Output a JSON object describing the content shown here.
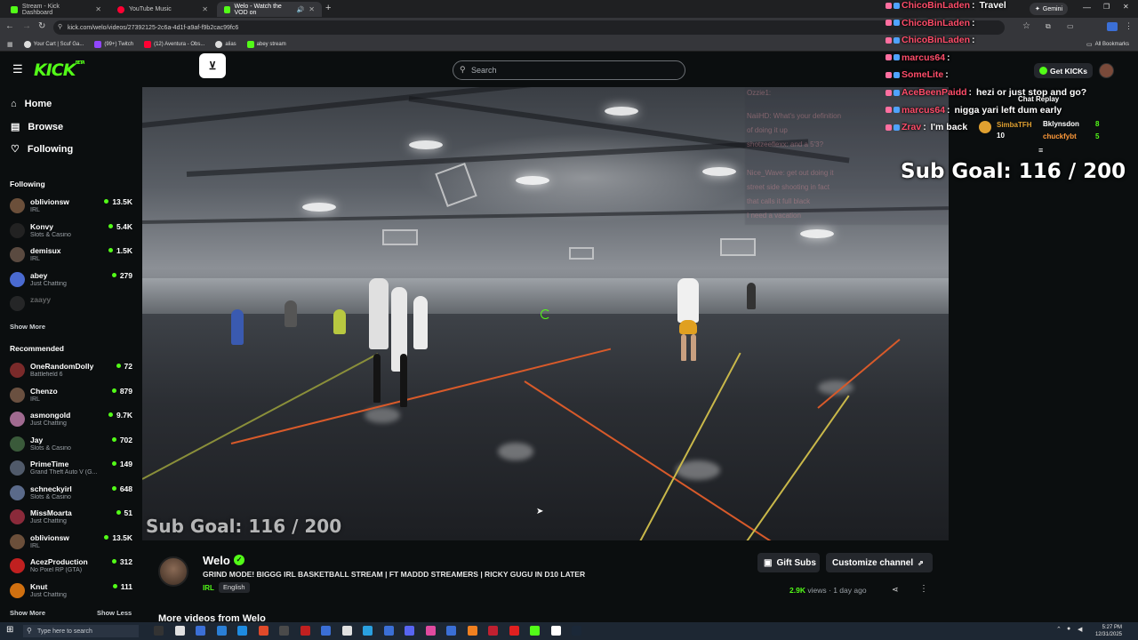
{
  "browser": {
    "tabs": [
      {
        "label": "Stream - Kick Dashboard",
        "color": "#53fc18"
      },
      {
        "label": "YouTube Music",
        "color": "#ff0033"
      },
      {
        "label": "Welo - Watch the VOD on",
        "color": "#53fc18"
      }
    ],
    "url": "kick.com/welo/videos/27392125-2c6a-4d1f-a9af-f9b2cac99fc6",
    "gemini_label": "Gemini",
    "bookmarks": [
      "Your Cart | Scuf Ga...",
      "(99+) Twitch",
      "(12) Aventura - Obs...",
      "alias",
      "abey stream"
    ],
    "all_bookmarks": "All Bookmarks"
  },
  "header": {
    "logo": "KICK",
    "logo_sup": "BETA",
    "search_placeholder": "Search",
    "get_kicks": "Get KICKs"
  },
  "sidebar": {
    "nav": [
      {
        "label": "Home",
        "icon": "home-icon"
      },
      {
        "label": "Browse",
        "icon": "browse-icon"
      },
      {
        "label": "Following",
        "icon": "heart-icon"
      }
    ],
    "following_title": "Following",
    "following": [
      {
        "name": "oblivionsw",
        "category": "IRL",
        "viewers": "13.5K",
        "color": "#6b4f3a"
      },
      {
        "name": "Konvy",
        "category": "Slots & Casino",
        "viewers": "5.4K",
        "color": "#222"
      },
      {
        "name": "demisux",
        "category": "IRL",
        "viewers": "1.5K",
        "color": "#5a4a40"
      },
      {
        "name": "abey",
        "category": "Just Chatting",
        "viewers": "279",
        "color": "#4a6ad0"
      },
      {
        "name": "zaayy",
        "category": "",
        "viewers": "",
        "color": "#555"
      }
    ],
    "following_more": "Show More",
    "recommended_title": "Recommended",
    "recommended": [
      {
        "name": "OneRandomDolly",
        "category": "Battlefield 6",
        "viewers": "72",
        "color": "#7a2a2a"
      },
      {
        "name": "Chenzo",
        "category": "IRL",
        "viewers": "879",
        "color": "#6a5040"
      },
      {
        "name": "asmongold",
        "category": "Just Chatting",
        "viewers": "9.7K",
        "color": "#a06a90"
      },
      {
        "name": "Jay",
        "category": "Slots & Casino",
        "viewers": "702",
        "color": "#3a5a3a"
      },
      {
        "name": "PrimeTime",
        "category": "Grand Theft Auto V (G...",
        "viewers": "149",
        "color": "#505a6a"
      },
      {
        "name": "schneckyirl",
        "category": "Slots & Casino",
        "viewers": "648",
        "color": "#5a6a8a"
      },
      {
        "name": "MissMoarta",
        "category": "Just Chatting",
        "viewers": "51",
        "color": "#8a2a3a"
      },
      {
        "name": "oblivionsw",
        "category": "IRL",
        "viewers": "13.5K",
        "color": "#6b4f3a"
      },
      {
        "name": "AcezProduction",
        "category": "No Pixel RP (GTA)",
        "viewers": "312",
        "color": "#c02020"
      },
      {
        "name": "Knut",
        "category": "Just Chatting",
        "viewers": "111",
        "color": "#d07010"
      }
    ],
    "show_more": "Show More",
    "show_less": "Show Less"
  },
  "video": {
    "sub_goal": "Sub Goal:  116 / 200",
    "faded_chat": [
      "Ozzie1: ",
      "NaiiHD: What's your definition",
      "of doing it up",
      "shotzeeflexx: and a 5'3?",
      "Nice_Wave: get out doing it",
      "street side shooting in fact",
      "that calls it full black",
      "I need a vacation"
    ]
  },
  "info": {
    "streamer": "Welo",
    "title": "GRIND MODE! BIGGG IRL BASKETBALL STREAM | FT MADDD STREAMERS | RICKY GUGU IN D10 LATER",
    "category": "IRL",
    "language": "English",
    "gift_subs": "Gift Subs",
    "customize": "Customize channel",
    "views": "2.9K",
    "views_label": "views",
    "age": "1 day ago",
    "more_videos": "More videos from Welo"
  },
  "chat_overlay": {
    "messages": [
      {
        "user": "ChicoBinLaden",
        "text": "Travel",
        "color": "#ff4d6a"
      },
      {
        "user": "ChicoBinLaden",
        "text": "",
        "color": "#ff4d6a"
      },
      {
        "user": "ChicoBinLaden",
        "text": "",
        "color": "#ff4d6a"
      },
      {
        "user": "marcus64",
        "text": "",
        "color": "#ff4d6a"
      },
      {
        "user": "SomeLite",
        "text": "",
        "color": "#ff4d6a"
      },
      {
        "user": "AceBeenPaidd",
        "text": "hezi or just stop and go?",
        "color": "#ff4d6a"
      },
      {
        "user": "marcus64",
        "text": "nigga yari left dum early",
        "color": "#ff4d6a"
      },
      {
        "user": "Zrav",
        "text": "I'm back",
        "color": "#ff4d6a"
      }
    ],
    "chat_replay": "Chat Replay",
    "sub_goal": "Sub Goal:  116 / 200",
    "leaderboard": [
      {
        "name": "SimbaTFH",
        "count": "10",
        "color": "#e0a030"
      },
      {
        "name": "Bklynsdon",
        "count": "8",
        "color": "#ffffff"
      },
      {
        "name": "chuckfybt",
        "count": "5",
        "color": "#ff9a3a"
      }
    ]
  },
  "taskbar": {
    "search_placeholder": "Type here to search",
    "time": "5:27 PM",
    "date": "12/31/2025"
  }
}
